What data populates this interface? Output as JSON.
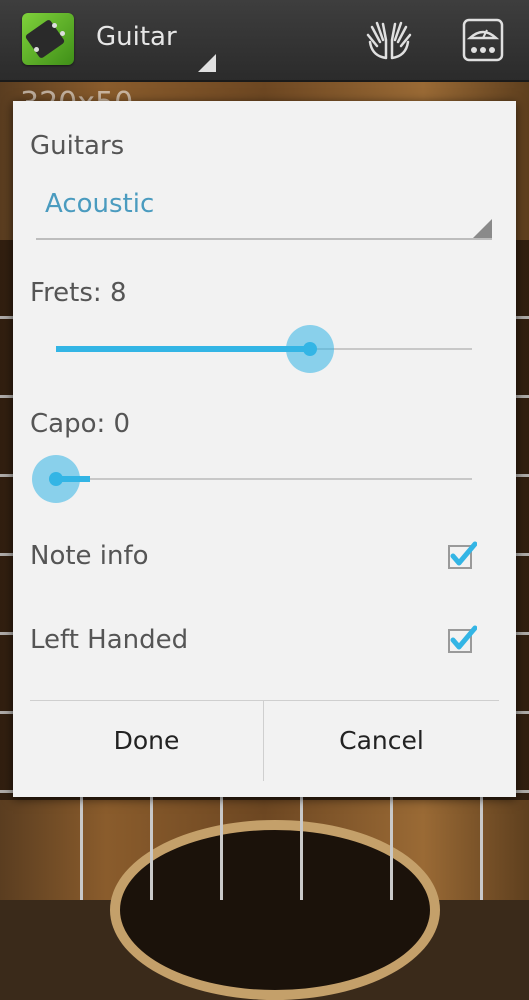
{
  "action_bar": {
    "title": "Guitar",
    "icons": [
      "guitar-headstock-icon",
      "hands-icon",
      "tuner-icon"
    ]
  },
  "background": {
    "ad_label": "320x50"
  },
  "dialog": {
    "guitars_label": "Guitars",
    "guitar_type": "Acoustic",
    "frets_label": "Frets: 8",
    "frets_value": 0.61,
    "capo_label": "Capo: 0",
    "capo_value": 0,
    "note_info_label": "Note info",
    "note_info_checked": true,
    "left_handed_label": "Left Handed",
    "left_handed_checked": true,
    "done_label": "Done",
    "cancel_label": "Cancel"
  },
  "colors": {
    "accent": "#33b5e5",
    "select_text": "#4a9bbf",
    "dialog_bg": "#f2f2f2"
  }
}
